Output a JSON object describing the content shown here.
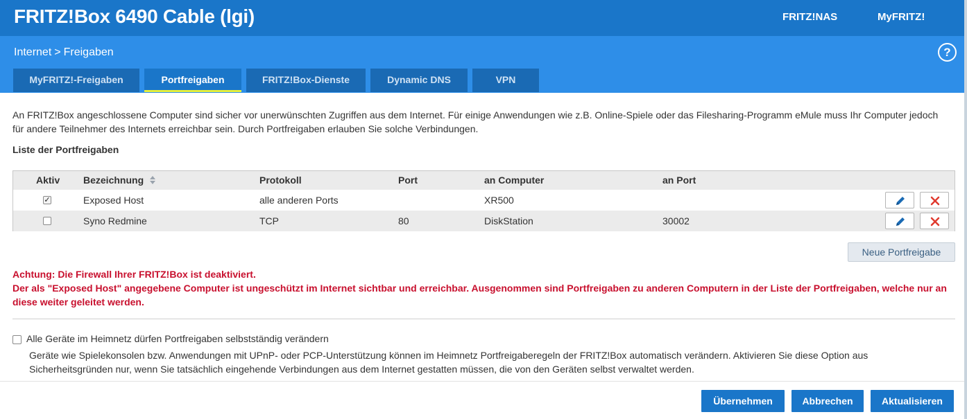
{
  "header": {
    "title": "FRITZ!Box 6490 Cable (lgi)",
    "links": [
      "FRITZ!NAS",
      "MyFRITZ!"
    ]
  },
  "breadcrumb": {
    "parent": "Internet",
    "separator": ">",
    "current": "Freigaben"
  },
  "help_label": "?",
  "tabs": [
    {
      "label": "MyFRITZ!-Freigaben",
      "active": false
    },
    {
      "label": "Portfreigaben",
      "active": true
    },
    {
      "label": "FRITZ!Box-Dienste",
      "active": false
    },
    {
      "label": "Dynamic DNS",
      "active": false
    },
    {
      "label": "VPN",
      "active": false
    }
  ],
  "intro_text": "An FRITZ!Box angeschlossene Computer sind sicher vor unerwünschten Zugriffen aus dem Internet. Für einige Anwendungen wie z.B. Online-Spiele oder das Filesharing-Programm eMule muss Ihr Computer jedoch für andere Teilnehmer des Internets erreichbar sein. Durch Portfreigaben erlauben Sie solche Verbindungen.",
  "list_title": "Liste der Portfreigaben",
  "table": {
    "columns": [
      "Aktiv",
      "Bezeichnung",
      "Protokoll",
      "Port",
      "an Computer",
      "an Port"
    ],
    "rows": [
      {
        "active": true,
        "name": "Exposed Host",
        "protocol": "alle anderen Ports",
        "port": "",
        "computer": "XR500",
        "to_port": ""
      },
      {
        "active": false,
        "name": "Syno Redmine",
        "protocol": "TCP",
        "port": "80",
        "computer": "DiskStation",
        "to_port": "30002"
      }
    ]
  },
  "new_button": "Neue Portfreigabe",
  "warning": {
    "line1": "Achtung: Die Firewall Ihrer FRITZ!Box ist deaktiviert.",
    "line2": "Der als \"Exposed Host\" angegebene Computer ist ungeschützt im Internet sichtbar und erreichbar. Ausgenommen sind Portfreigaben zu anderen Computern in der Liste der Portfreigaben, welche nur an diese weiter geleitet werden."
  },
  "option": {
    "checked": false,
    "label": "Alle Geräte im Heimnetz dürfen Portfreigaben selbstständig verändern",
    "description": "Geräte wie Spielekonsolen bzw. Anwendungen mit UPnP- oder PCP-Unterstützung können im Heimnetz Portfreigaberegeln der FRITZ!Box automatisch verändern. Aktivieren Sie diese Option aus Sicherheitsgründen nur, wenn Sie tatsächlich eingehende Verbindungen aus dem Internet gestatten müssen, die von den Geräten selbst verwaltet werden."
  },
  "buttons": {
    "apply": "Übernehmen",
    "cancel": "Abbrechen",
    "refresh": "Aktualisieren"
  },
  "colors": {
    "header_bg": "#1a76c9",
    "subbar_bg": "#2e8ee8",
    "tab_active_underline": "#e6f03c",
    "warning_text": "#c8102e",
    "edit_icon": "#1a6ab4",
    "delete_icon": "#e03a2e"
  },
  "icons": {
    "edit": "pencil-icon",
    "delete": "close-icon",
    "sort": "sort-arrows-icon",
    "help": "help-icon"
  }
}
